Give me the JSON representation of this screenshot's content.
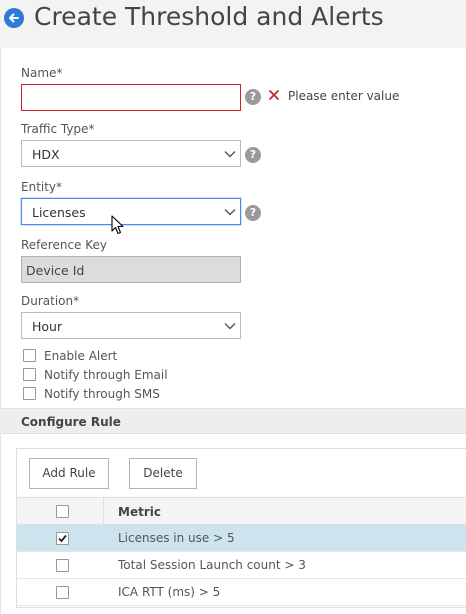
{
  "page": {
    "title": "Create Threshold and Alerts"
  },
  "form": {
    "name": {
      "label": "Name*",
      "value": "",
      "error": "Please enter value"
    },
    "traffic_type": {
      "label": "Traffic Type*",
      "value": "HDX"
    },
    "entity": {
      "label": "Entity*",
      "value": "Licenses"
    },
    "reference_key": {
      "label": "Reference Key",
      "value": "Device Id"
    },
    "duration": {
      "label": "Duration*",
      "value": "Hour"
    },
    "checkboxes": [
      {
        "label": "Enable Alert",
        "checked": false
      },
      {
        "label": "Notify through Email",
        "checked": false
      },
      {
        "label": "Notify through SMS",
        "checked": false
      }
    ]
  },
  "rules": {
    "section_title": "Configure Rule",
    "add_label": "Add Rule",
    "delete_label": "Delete",
    "column_header": "Metric",
    "rows": [
      {
        "metric": "Licenses in use > 5",
        "checked": true
      },
      {
        "metric": "Total Session Launch count > 3",
        "checked": false
      },
      {
        "metric": "ICA RTT (ms) > 5",
        "checked": false
      }
    ]
  },
  "icons": {
    "back": "back-arrow-icon",
    "help": "help-icon",
    "error": "close-icon",
    "dropdown": "chevron-down-icon",
    "cursor": "mouse-cursor-icon"
  },
  "colors": {
    "accent": "#2f7bd4",
    "error": "#c8232c",
    "selected_row": "#cde4ee"
  }
}
